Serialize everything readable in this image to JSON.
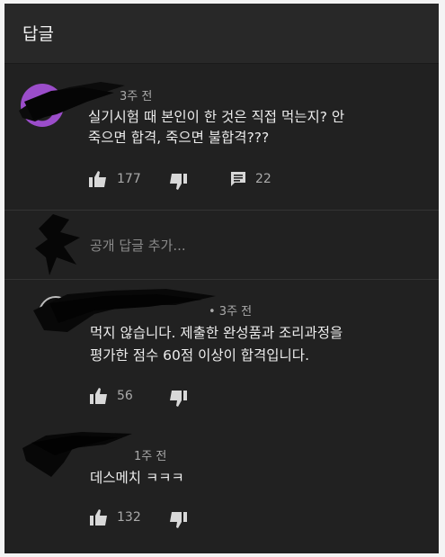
{
  "header": {
    "title": "답글"
  },
  "comments": [
    {
      "time": "3주 전",
      "text_lines": [
        "실기시험 때 본인이 한 것은 직접 먹는지?  안",
        "죽으면 합격, 죽으면 불합격???"
      ],
      "likes": "177",
      "replies": "22"
    },
    {
      "time": "• 3주 전",
      "text_lines": [
        "먹지 않습니다. 제출한 완성품과 조리과정을",
        "평가한 점수 60점 이상이 합격입니다."
      ],
      "likes": "56"
    },
    {
      "time": "1주 전",
      "text_lines": [
        "데스메치 ㅋㅋㅋ"
      ],
      "likes": "132"
    }
  ],
  "reply_box": {
    "placeholder": "공개 답글 추가..."
  },
  "colors": {
    "background": "#212121",
    "header": "#282828",
    "text": "#ececec",
    "meta": "#aaaaaa",
    "avatar_accent": "#9b4dca"
  },
  "icons": [
    "thumbs-up-icon",
    "thumbs-down-icon",
    "comment-icon"
  ]
}
